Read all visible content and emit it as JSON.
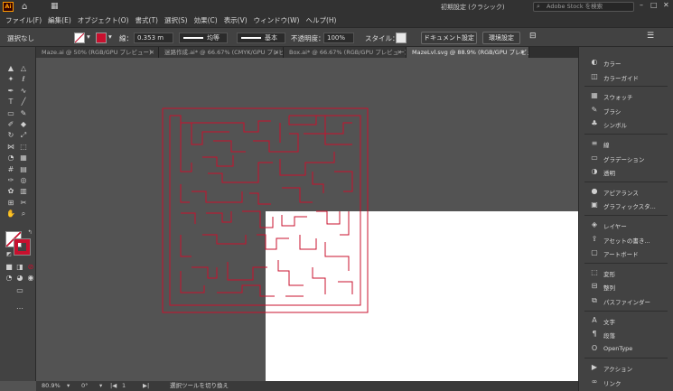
{
  "titlebar": {
    "logo": "Ai",
    "home_icon": "⌂",
    "workspace_icon": "▦",
    "preset": "初期設定 (クラシック)",
    "stock_search_placeholder": "Adobe Stock を検索",
    "minimize": "–",
    "maximize": "□",
    "close": "✕"
  },
  "menu": [
    "ファイル(F)",
    "編集(E)",
    "オブジェクト(O)",
    "書式(T)",
    "選択(S)",
    "効果(C)",
    "表示(V)",
    "ウィンドウ(W)",
    "ヘルプ(H)"
  ],
  "control": {
    "selection": "選択なし",
    "stroke_label": "線：",
    "stroke_value": "0.353 m",
    "profile1": "均等",
    "profile2": "基本",
    "opacity_label": "不透明度：",
    "opacity_value": "100%",
    "style_label": "スタイル：",
    "doc_settings": "ドキュメント設定",
    "env_settings": "環境設定",
    "stroke_color": "#c8102e"
  },
  "tabs": [
    {
      "label": "Maze.ai @ 50% (RGB/GPU プレビュー)",
      "active": false
    },
    {
      "label": "迷路作成.ai* @ 66.67% (CMYK/GPU プレビュー)",
      "active": false
    },
    {
      "label": "Box.ai* @ 66.67% (RGB/GPU プレビュー)",
      "active": false
    },
    {
      "label": "MazeLvl.svg @ 88.9% (RGB/GPU プレビュー)",
      "active": true
    }
  ],
  "status": {
    "zoom": "80.9%",
    "rotation": "0°",
    "artboard": "1",
    "tool_hint": "選択ツールを切り換え"
  },
  "panels": [
    {
      "icon": "color-icon",
      "glyph": "◐",
      "label": "カラー"
    },
    {
      "icon": "color-guide-icon",
      "glyph": "◫",
      "label": "カラーガイド"
    },
    {
      "icon": "swatches-icon",
      "glyph": "▦",
      "label": "スウォッチ"
    },
    {
      "icon": "brushes-icon",
      "glyph": "✎",
      "label": "ブラシ"
    },
    {
      "icon": "symbols-icon",
      "glyph": "♣",
      "label": "シンボル"
    },
    {
      "icon": "stroke-icon",
      "glyph": "≡",
      "label": "線"
    },
    {
      "icon": "gradient-icon",
      "glyph": "▭",
      "label": "グラデーション"
    },
    {
      "icon": "transparency-icon",
      "glyph": "◑",
      "label": "透明"
    },
    {
      "icon": "appearance-icon",
      "glyph": "●",
      "label": "アピアランス"
    },
    {
      "icon": "graphic-styles-icon",
      "glyph": "▣",
      "label": "グラフィックスタ..."
    },
    {
      "icon": "layers-icon",
      "glyph": "◈",
      "label": "レイヤー"
    },
    {
      "icon": "asset-export-icon",
      "glyph": "⇪",
      "label": "アセットの書き..."
    },
    {
      "icon": "artboards-icon",
      "glyph": "▢",
      "label": "アートボード"
    },
    {
      "icon": "transform-icon",
      "glyph": "⬚",
      "label": "変形"
    },
    {
      "icon": "align-icon",
      "glyph": "⊟",
      "label": "整列"
    },
    {
      "icon": "pathfinder-icon",
      "glyph": "⧉",
      "label": "パスファインダー"
    },
    {
      "icon": "character-icon",
      "glyph": "A",
      "label": "文字"
    },
    {
      "icon": "paragraph-icon",
      "glyph": "¶",
      "label": "段落"
    },
    {
      "icon": "opentype-icon",
      "glyph": "O",
      "label": "OpenType"
    },
    {
      "icon": "actions-icon",
      "glyph": "▶",
      "label": "アクション"
    },
    {
      "icon": "links-icon",
      "glyph": "∞",
      "label": "リンク"
    }
  ],
  "tools": [
    {
      "name": "selection-tool-icon",
      "glyph": "▲"
    },
    {
      "name": "direct-selection-tool-icon",
      "glyph": "△"
    },
    {
      "name": "magic-wand-tool-icon",
      "glyph": "✦"
    },
    {
      "name": "lasso-tool-icon",
      "glyph": "ℓ"
    },
    {
      "name": "pen-tool-icon",
      "glyph": "✒"
    },
    {
      "name": "curvature-tool-icon",
      "glyph": "∿"
    },
    {
      "name": "type-tool-icon",
      "glyph": "T"
    },
    {
      "name": "line-tool-icon",
      "glyph": "╱"
    },
    {
      "name": "rectangle-tool-icon",
      "glyph": "▭"
    },
    {
      "name": "paintbrush-tool-icon",
      "glyph": "✎"
    },
    {
      "name": "shaper-tool-icon",
      "glyph": "✐"
    },
    {
      "name": "eraser-tool-icon",
      "glyph": "◆"
    },
    {
      "name": "rotate-tool-icon",
      "glyph": "↻"
    },
    {
      "name": "scale-tool-icon",
      "glyph": "⤢"
    },
    {
      "name": "width-tool-icon",
      "glyph": "⋈"
    },
    {
      "name": "free-transform-tool-icon",
      "glyph": "⬚"
    },
    {
      "name": "shape-builder-tool-icon",
      "glyph": "◔"
    },
    {
      "name": "perspective-grid-tool-icon",
      "glyph": "▦"
    },
    {
      "name": "mesh-tool-icon",
      "glyph": "#"
    },
    {
      "name": "gradient-tool-icon",
      "glyph": "▤"
    },
    {
      "name": "eyedropper-tool-icon",
      "glyph": "✑"
    },
    {
      "name": "blend-tool-icon",
      "glyph": "◎"
    },
    {
      "name": "symbol-sprayer-tool-icon",
      "glyph": "✿"
    },
    {
      "name": "graph-tool-icon",
      "glyph": "▥"
    },
    {
      "name": "artboard-tool-icon",
      "glyph": "⊞"
    },
    {
      "name": "slice-tool-icon",
      "glyph": "✂"
    },
    {
      "name": "hand-tool-icon",
      "glyph": "✋"
    },
    {
      "name": "zoom-tool-icon",
      "glyph": "⌕"
    }
  ],
  "colors": {
    "maze_stroke": "#c8102e",
    "canvas": "#535353",
    "artboard": "#ffffff"
  }
}
